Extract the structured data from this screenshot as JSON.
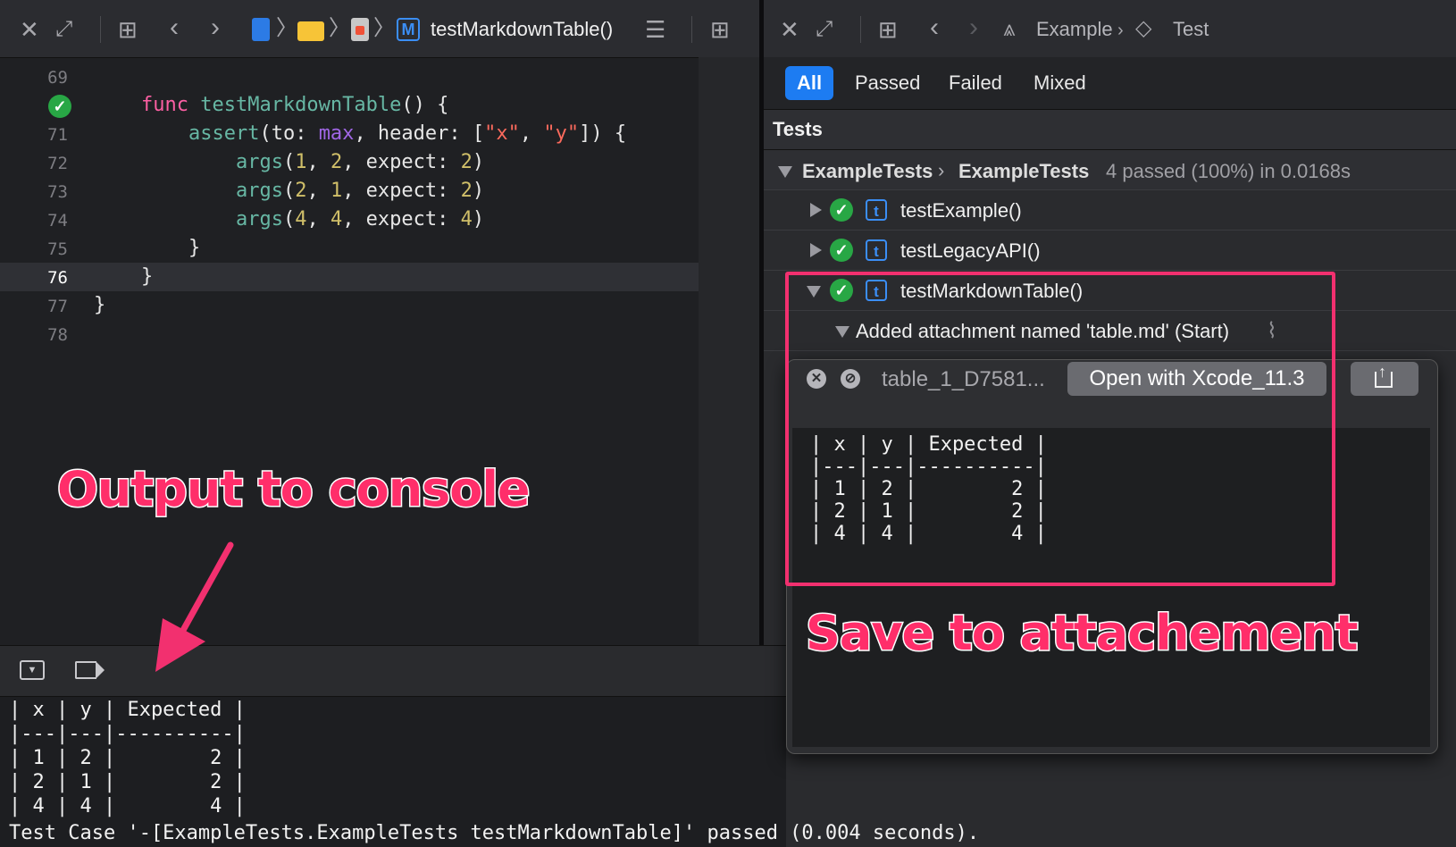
{
  "editor": {
    "breadcrumb_title": "testMarkdownTable()",
    "lines": [
      {
        "num": "69",
        "parts": []
      },
      {
        "num": "",
        "parts": [
          {
            "t": "    "
          },
          {
            "t": "func",
            "c": "kw"
          },
          {
            "t": " "
          },
          {
            "t": "testMarkdownTable",
            "c": "fn"
          },
          {
            "t": "() {"
          }
        ]
      },
      {
        "num": "71",
        "parts": [
          {
            "t": "        "
          },
          {
            "t": "assert",
            "c": "fn"
          },
          {
            "t": "(to: "
          },
          {
            "t": "max",
            "c": "purple"
          },
          {
            "t": ", header: ["
          },
          {
            "t": "\"x\"",
            "c": "str"
          },
          {
            "t": ", "
          },
          {
            "t": "\"y\"",
            "c": "str"
          },
          {
            "t": "]) {"
          }
        ]
      },
      {
        "num": "72",
        "parts": [
          {
            "t": "            "
          },
          {
            "t": "args",
            "c": "fn"
          },
          {
            "t": "("
          },
          {
            "t": "1",
            "c": "num"
          },
          {
            "t": ", "
          },
          {
            "t": "2",
            "c": "num"
          },
          {
            "t": ", expect: "
          },
          {
            "t": "2",
            "c": "num"
          },
          {
            "t": ")"
          }
        ]
      },
      {
        "num": "73",
        "parts": [
          {
            "t": "            "
          },
          {
            "t": "args",
            "c": "fn"
          },
          {
            "t": "("
          },
          {
            "t": "2",
            "c": "num"
          },
          {
            "t": ", "
          },
          {
            "t": "1",
            "c": "num"
          },
          {
            "t": ", expect: "
          },
          {
            "t": "2",
            "c": "num"
          },
          {
            "t": ")"
          }
        ]
      },
      {
        "num": "74",
        "parts": [
          {
            "t": "            "
          },
          {
            "t": "args",
            "c": "fn"
          },
          {
            "t": "("
          },
          {
            "t": "4",
            "c": "num"
          },
          {
            "t": ", "
          },
          {
            "t": "4",
            "c": "num"
          },
          {
            "t": ", expect: "
          },
          {
            "t": "4",
            "c": "num"
          },
          {
            "t": ")"
          }
        ]
      },
      {
        "num": "75",
        "parts": [
          {
            "t": "        }"
          }
        ]
      },
      {
        "num": "76",
        "parts": [
          {
            "t": "    }"
          }
        ],
        "current": true
      },
      {
        "num": "77",
        "parts": [
          {
            "t": "}"
          }
        ]
      },
      {
        "num": "78",
        "parts": []
      }
    ]
  },
  "right": {
    "breadcrumb": [
      "Example",
      "Test"
    ],
    "filter_tabs": [
      "All",
      "Passed",
      "Failed",
      "Mixed"
    ],
    "section_title": "Tests",
    "group": {
      "name1": "ExampleTests",
      "name2": "ExampleTests",
      "summary": "4 passed (100%) in 0.0168s"
    },
    "tests": [
      "testExample()",
      "testLegacyAPI()",
      "testMarkdownTable()"
    ],
    "attachment_row": "Added attachment named 'table.md' (Start)"
  },
  "popup": {
    "filename": "table_1_D7581...",
    "open_with": "Open with Xcode_11.3",
    "lines": [
      "| x | y | Expected |",
      "|---|---|----------|",
      "| 1 | 2 |        2 |",
      "| 2 | 1 |        2 |",
      "| 4 | 4 |        4 |"
    ]
  },
  "console": {
    "lines": [
      "| x | y | Expected |",
      "|---|---|----------|",
      "| 1 | 2 |        2 |",
      "| 2 | 1 |        2 |",
      "| 4 | 4 |        4 |",
      "Test Case '-[ExampleTests.ExampleTests testMarkdownTable]' passed (0.004 seconds)."
    ]
  },
  "annotations": {
    "console": "Output to console",
    "attachment": "Save to attachement"
  },
  "colors": {
    "accent": "#1d7cf2",
    "highlight": "#f2306f",
    "check_green": "#28a745"
  }
}
